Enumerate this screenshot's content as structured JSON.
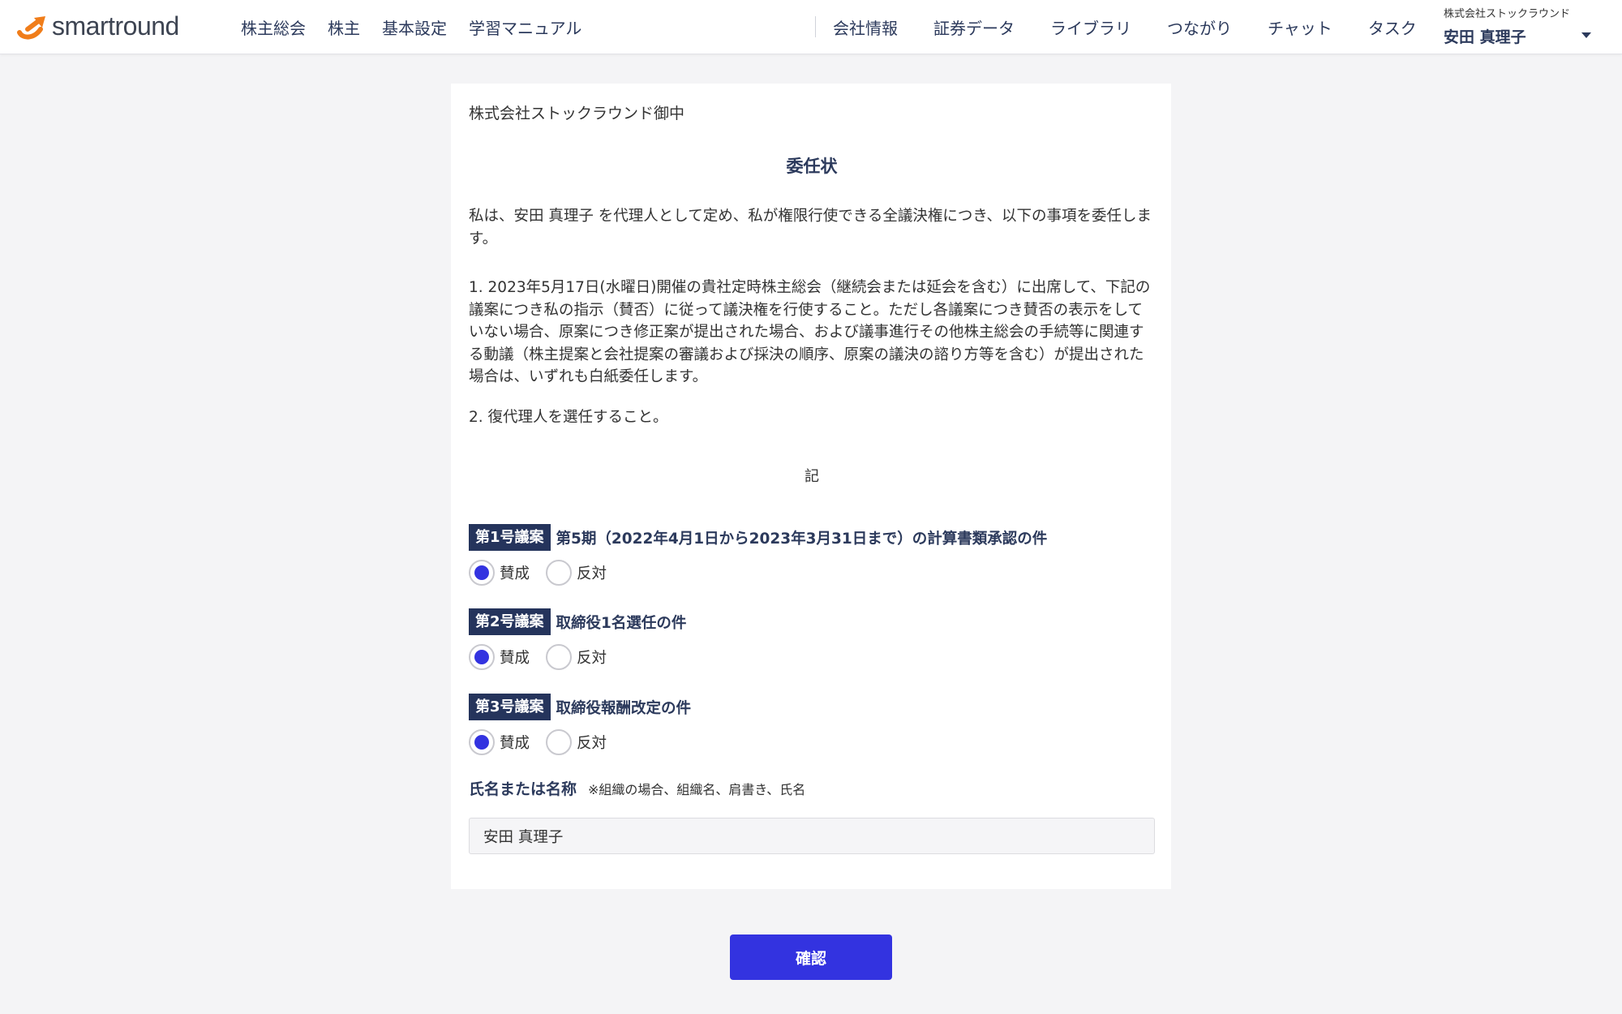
{
  "header": {
    "logo_text": "smartround",
    "nav_left": [
      "株主総会",
      "株主",
      "基本設定",
      "学習マニュアル"
    ],
    "nav_right": [
      "会社情報",
      "証券データ",
      "ライブラリ",
      "つながり",
      "チャット",
      "タスク"
    ],
    "user": {
      "company": "株式会社ストックラウンド",
      "name": "安田 真理子"
    }
  },
  "document": {
    "addressee": "株式会社ストックラウンド御中",
    "title": "委任状",
    "paragraph1": "私は、安田 真理子 を代理人として定め、私が権限行使できる全議決権につき、以下の事項を委任します。",
    "paragraph2": "1. 2023年5月17日(水曜日)開催の貴社定時株主総会（継続会または延会を含む）に出席して、下記の議案につき私の指示（賛否）に従って議決権を行使すること。ただし各議案につき賛否の表示をしていない場合、原案につき修正案が提出された場合、および議事進行その他株主総会の手続等に関連する動議（株主提案と会社提案の審議および採決の順序、原案の議決の諮り方等を含む）が提出された場合は、いずれも白紙委任します。",
    "paragraph3": "2. 復代理人を選任すること。",
    "ki": "記"
  },
  "agendas": [
    {
      "badge": "第1号議案",
      "title": "第5期（2022年4月1日から2023年3月31日まで）の計算書類承認の件",
      "approve": "賛成",
      "oppose": "反対",
      "selected": "賛成"
    },
    {
      "badge": "第2号議案",
      "title": "取締役1名選任の件",
      "approve": "賛成",
      "oppose": "反対",
      "selected": "賛成"
    },
    {
      "badge": "第3号議案",
      "title": "取締役報酬改定の件",
      "approve": "賛成",
      "oppose": "反対",
      "selected": "賛成"
    }
  ],
  "name_field": {
    "label": "氏名または名称",
    "note": "※組織の場合、組織名、肩書き、氏名",
    "value": "安田 真理子"
  },
  "confirm_label": "確認",
  "colors": {
    "accent": "#3333e0",
    "navy": "#25345c",
    "logo_orange": "#f07d1a"
  }
}
